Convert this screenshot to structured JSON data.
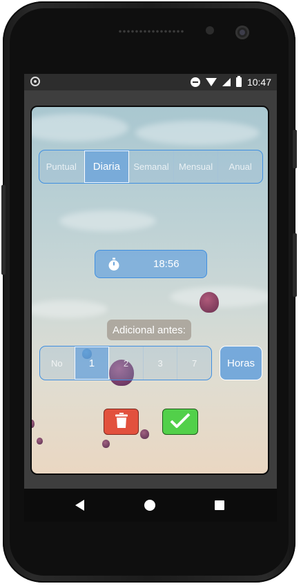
{
  "statusbar": {
    "time": "10:47"
  },
  "periodicity": {
    "options": [
      {
        "label": "Puntual",
        "active": false
      },
      {
        "label": "Diaria",
        "active": true
      },
      {
        "label": "Semanal",
        "active": false
      },
      {
        "label": "Mensual",
        "active": false
      },
      {
        "label": "Anual",
        "active": false
      }
    ]
  },
  "time_picker": {
    "value": "18:56"
  },
  "advance": {
    "label": "Adicional antes:",
    "options": [
      {
        "label": "No",
        "active": false
      },
      {
        "label": "1",
        "active": true
      },
      {
        "label": "2",
        "active": false
      },
      {
        "label": "3",
        "active": false
      },
      {
        "label": "7",
        "active": false
      }
    ],
    "unit_label": "Horas"
  },
  "colors": {
    "delete": "#e2513d",
    "confirm": "#52d04a",
    "accent": "#3f8fe0"
  }
}
